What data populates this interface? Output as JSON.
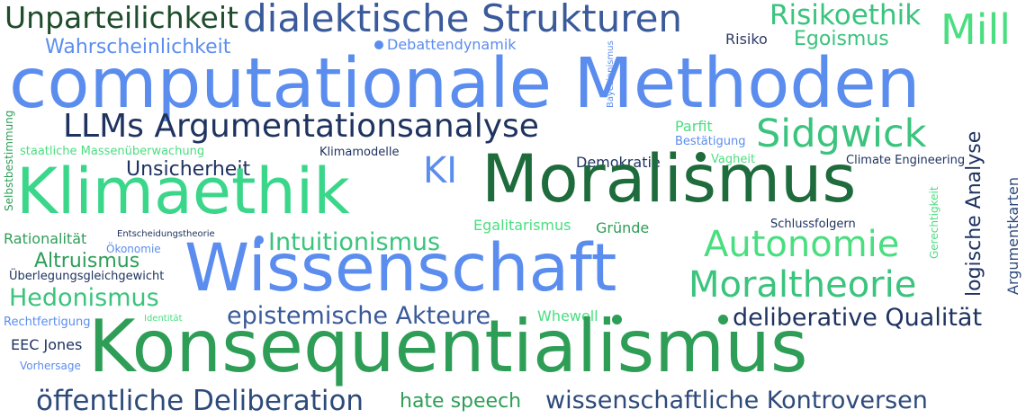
{
  "cloud": {
    "words": [
      {
        "text": "Unparteilichkeit",
        "color": "#1e4d2b"
      },
      {
        "text": "dialektische Strukturen",
        "color": "#3a5a9a"
      },
      {
        "text": "Risikoethik",
        "color": "#3ac47d"
      },
      {
        "text": "Mill",
        "color": "#4ade80"
      },
      {
        "text": "Wahrscheinlichkeit",
        "color": "#5b8def"
      },
      {
        "text": "Debattendynamik",
        "color": "#5b8def"
      },
      {
        "text": "Risiko",
        "color": "#2d3a66"
      },
      {
        "text": "Egoismus",
        "color": "#3ac47d"
      },
      {
        "text": "Bayesianismus",
        "color": "#5b8def"
      },
      {
        "text": "computationale Methoden",
        "color": "#5b8def"
      },
      {
        "text": "Selbstbestimmung",
        "color": "#2e9e57"
      },
      {
        "text": "LLMs Argumentationsanalyse",
        "color": "#1f3360"
      },
      {
        "text": "Parfit",
        "color": "#4ade80"
      },
      {
        "text": "Bestätigung",
        "color": "#5b8def"
      },
      {
        "text": "Sidgwick",
        "color": "#3ac47d"
      },
      {
        "text": "staatliche Massenüberwachung",
        "color": "#4ade80"
      },
      {
        "text": "Klimamodelle",
        "color": "#1f3360"
      },
      {
        "text": "Vagheit",
        "color": "#4ade80"
      },
      {
        "text": "Climate Engineering",
        "color": "#1f3360"
      },
      {
        "text": "logische Analyse",
        "color": "#1f3360"
      },
      {
        "text": "Unsicherheit",
        "color": "#1f3360"
      },
      {
        "text": "KI",
        "color": "#5b8def"
      },
      {
        "text": "Demokratie",
        "color": "#1f3360"
      },
      {
        "text": "Moralismus",
        "color": "#1e6b3c"
      },
      {
        "text": "Klimaethik",
        "color": "#3ad68a"
      },
      {
        "text": "Gerechtigkeit",
        "color": "#4ade80"
      },
      {
        "text": "Argumentkarten",
        "color": "#2d4a7a"
      },
      {
        "text": "Egalitarismus",
        "color": "#4ade80"
      },
      {
        "text": "Gründe",
        "color": "#2e9e57"
      },
      {
        "text": "Schlussfolgern",
        "color": "#1f3360"
      },
      {
        "text": "Rationalität",
        "color": "#2e9e57"
      },
      {
        "text": "Entscheidungstheorie",
        "color": "#1f3360"
      },
      {
        "text": "Intuitionismus",
        "color": "#3ac47d"
      },
      {
        "text": "Autonomie",
        "color": "#4ade80"
      },
      {
        "text": "Ökonomie",
        "color": "#5b8def"
      },
      {
        "text": "Altruismus",
        "color": "#2e9e57"
      },
      {
        "text": "Wissenschaft",
        "color": "#5b8def"
      },
      {
        "text": "Überlegungsgleichgewicht",
        "color": "#1f3360"
      },
      {
        "text": "Moraltheorie",
        "color": "#3ac47d"
      },
      {
        "text": "Hedonismus",
        "color": "#3ac47d"
      },
      {
        "text": "epistemische Akteure",
        "color": "#3a5a9a"
      },
      {
        "text": "Whewell",
        "color": "#4ade80"
      },
      {
        "text": "deliberative Qualität",
        "color": "#1f3360"
      },
      {
        "text": "Rechtfertigung",
        "color": "#5b8def"
      },
      {
        "text": "Identität",
        "color": "#4ade80"
      },
      {
        "text": "EEC Jones",
        "color": "#1f3360"
      },
      {
        "text": "Konsequentialismus",
        "color": "#2e9e57"
      },
      {
        "text": "Vorhersage",
        "color": "#5b8def"
      },
      {
        "text": "öffentliche Deliberation",
        "color": "#2d4a7a"
      },
      {
        "text": "hate speech",
        "color": "#2e9e57"
      },
      {
        "text": "wissenschaftliche Kontroversen",
        "color": "#2d4a7a"
      }
    ],
    "dot_colors": [
      "#5b8def",
      "#1e6b3c",
      "#5b8def",
      "#2e9e57",
      "#2e9e57"
    ]
  }
}
